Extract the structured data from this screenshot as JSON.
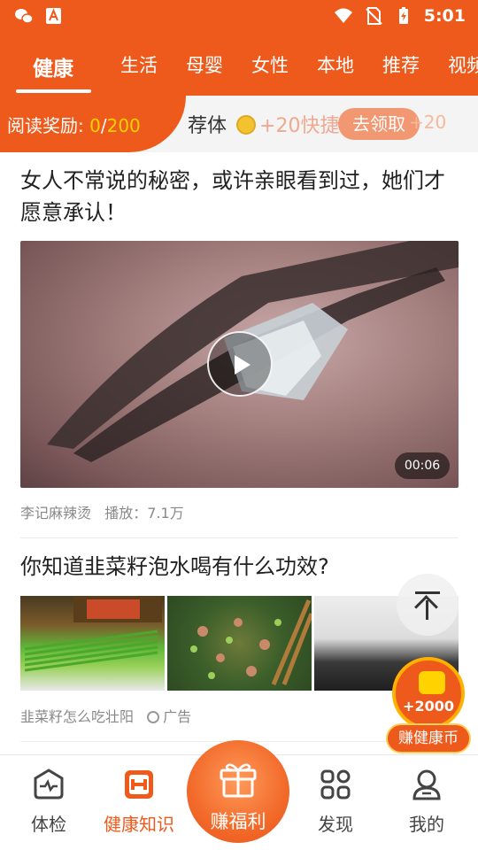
{
  "status_bar": {
    "time": "5:01",
    "icons": [
      "weixin-icon",
      "app-a-icon",
      "wifi-icon",
      "no-sim-icon",
      "battery-charging-icon"
    ]
  },
  "tabs": [
    {
      "label": "健康",
      "active": true
    },
    {
      "label": "生活"
    },
    {
      "label": "母婴"
    },
    {
      "label": "女性"
    },
    {
      "label": "本地"
    },
    {
      "label": "推荐"
    },
    {
      "label": "视频"
    }
  ],
  "reward_bar": {
    "prefix": "阅读奖励:",
    "current": "0",
    "separator": "/",
    "total": "200",
    "marquee_text": "荐体",
    "coin_reward": "+20",
    "marquee_text2": "快捷",
    "claim_button": "去领取",
    "coin_reward2": "+20"
  },
  "articles": [
    {
      "title": "女人不常说的秘密，或许亲眼看到过，她们才愿意承认！",
      "duration": "00:06",
      "source": "李记麻辣烫",
      "plays": "播放：7.1万"
    },
    {
      "title": "你知道韭菜籽泡水喝有什么功效?",
      "source": "韭菜籽怎么吃壮阳",
      "ad_label": "广告"
    }
  ],
  "floating": {
    "reward_amount": "+2000",
    "earn_label": "赚健康币"
  },
  "bottom_nav": [
    {
      "label": "体检",
      "icon": "health-check-icon"
    },
    {
      "label": "健康知识",
      "icon": "dumbbell-icon",
      "active": true
    },
    {
      "label": "赚福利",
      "icon": "gift-box-icon"
    },
    {
      "label": "发现",
      "icon": "discover-grid-icon"
    },
    {
      "label": "我的",
      "icon": "profile-icon"
    }
  ],
  "colors": {
    "brand": "#ee5a1c",
    "highlight": "#ffd200"
  }
}
